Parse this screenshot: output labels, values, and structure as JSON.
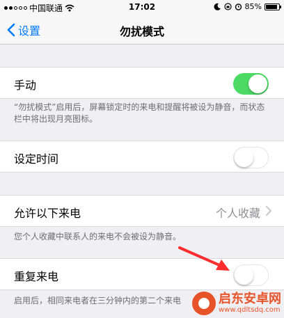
{
  "status_bar": {
    "carrier": "中国联通",
    "time": "17:02",
    "battery": "85%",
    "battery_level": 0.85
  },
  "nav": {
    "back_label": "设置",
    "title": "勿扰模式"
  },
  "manual": {
    "label": "手动",
    "enabled": true,
    "footnote": "“勿扰模式”启用后，屏幕锁定时的来电和提醒将被设为静音，而状态栏中将出现月亮图标。"
  },
  "scheduled": {
    "label": "设定时间",
    "enabled": false
  },
  "allow_calls": {
    "label": "允许以下来电",
    "value": "个人收藏",
    "footnote": "您个人收藏中联系人的来电不会被设为静音。"
  },
  "repeated_calls": {
    "label": "重复来电",
    "enabled": false,
    "footnote": "启用后，相同来电者在三分钟内的第二个来电"
  },
  "watermark": {
    "name": "启东安卓网",
    "url": "www.qdltsdq.com"
  },
  "colors": {
    "accent": "#007aff",
    "toggle_on": "#4cd964",
    "arrow": "#ff2d2d",
    "watermark": "#e8542a"
  }
}
